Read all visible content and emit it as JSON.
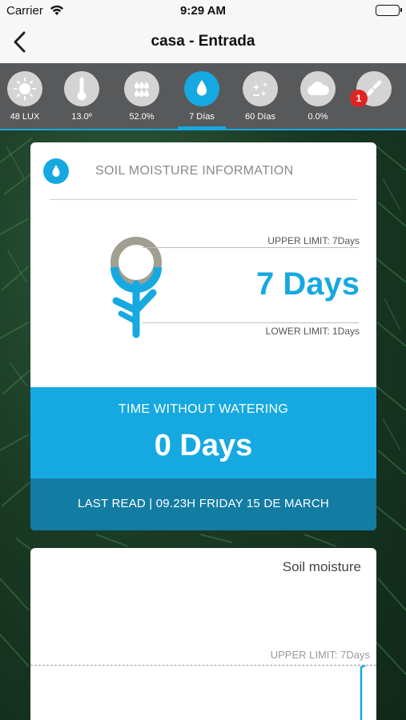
{
  "status_bar": {
    "carrier": "Carrier",
    "time": "9:29 AM"
  },
  "nav": {
    "title": "casa - Entrada"
  },
  "sensors": [
    {
      "icon": "sun-icon",
      "label": "48 LUX"
    },
    {
      "icon": "thermometer-icon",
      "label": "13.0º"
    },
    {
      "icon": "humidity-drops-icon",
      "label": "52.0%"
    },
    {
      "icon": "water-drop-icon",
      "label": "7 Días",
      "active": true
    },
    {
      "icon": "sparkle-days-icon",
      "label": "60 Días"
    },
    {
      "icon": "cloud-icon",
      "label": "0.0%"
    },
    {
      "icon": "fertilizer-icon",
      "label": ""
    }
  ],
  "alert_badge": "1",
  "colors": {
    "accent": "#16a9e1",
    "accent_dark": "#137ca3",
    "strip": "#58595b",
    "badge": "#e02424"
  },
  "moisture_card": {
    "title": "SOIL MOISTURE INFORMATION",
    "upper_limit": "UPPER LIMIT: 7Days",
    "current": "7 Days",
    "lower_limit": "LOWER LIMIT: 1Days",
    "time_without_watering_label": "TIME WITHOUT WATERING",
    "time_without_watering_value": "0 Days",
    "last_read": "LAST READ | 09.23H FRIDAY 15 DE MARCH"
  },
  "chart_card": {
    "title": "Soil moisture",
    "upper_limit_label": "UPPER LIMIT: 7Days"
  }
}
